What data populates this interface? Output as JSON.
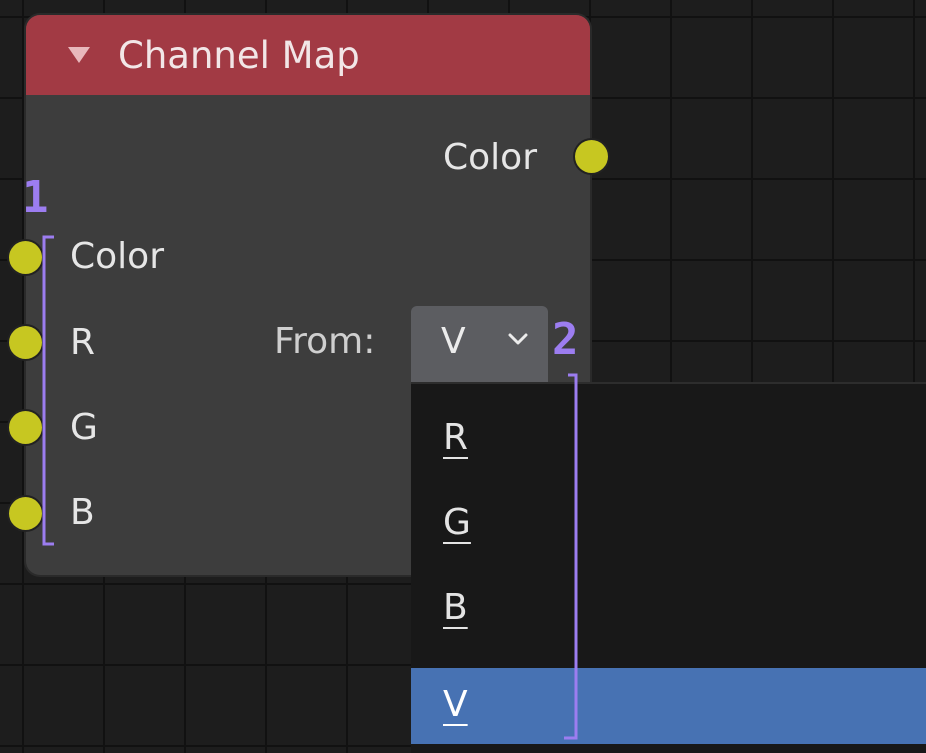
{
  "node": {
    "title": "Channel Map",
    "output_socket_label": "Color",
    "inputs": [
      {
        "label": "Color"
      },
      {
        "label": "R"
      },
      {
        "label": "G"
      },
      {
        "label": "B"
      }
    ],
    "from_label": "From:",
    "dropdown_value": "V"
  },
  "menu": {
    "items": [
      {
        "label": "R",
        "selected": false
      },
      {
        "label": "G",
        "selected": false
      },
      {
        "label": "B",
        "selected": false
      },
      {
        "label": "V",
        "selected": true
      }
    ]
  },
  "annotations": {
    "bracket_1_number": "1",
    "bracket_2_number": "2"
  },
  "colors": {
    "header": "#a23a44",
    "node_body": "#3d3d3d",
    "socket": "#c7c721",
    "selected_item": "#4772b3",
    "annotation": "#9c7df0"
  },
  "icons": {
    "collapse": "triangle-down-icon",
    "dropdown": "chevron-down-icon"
  }
}
